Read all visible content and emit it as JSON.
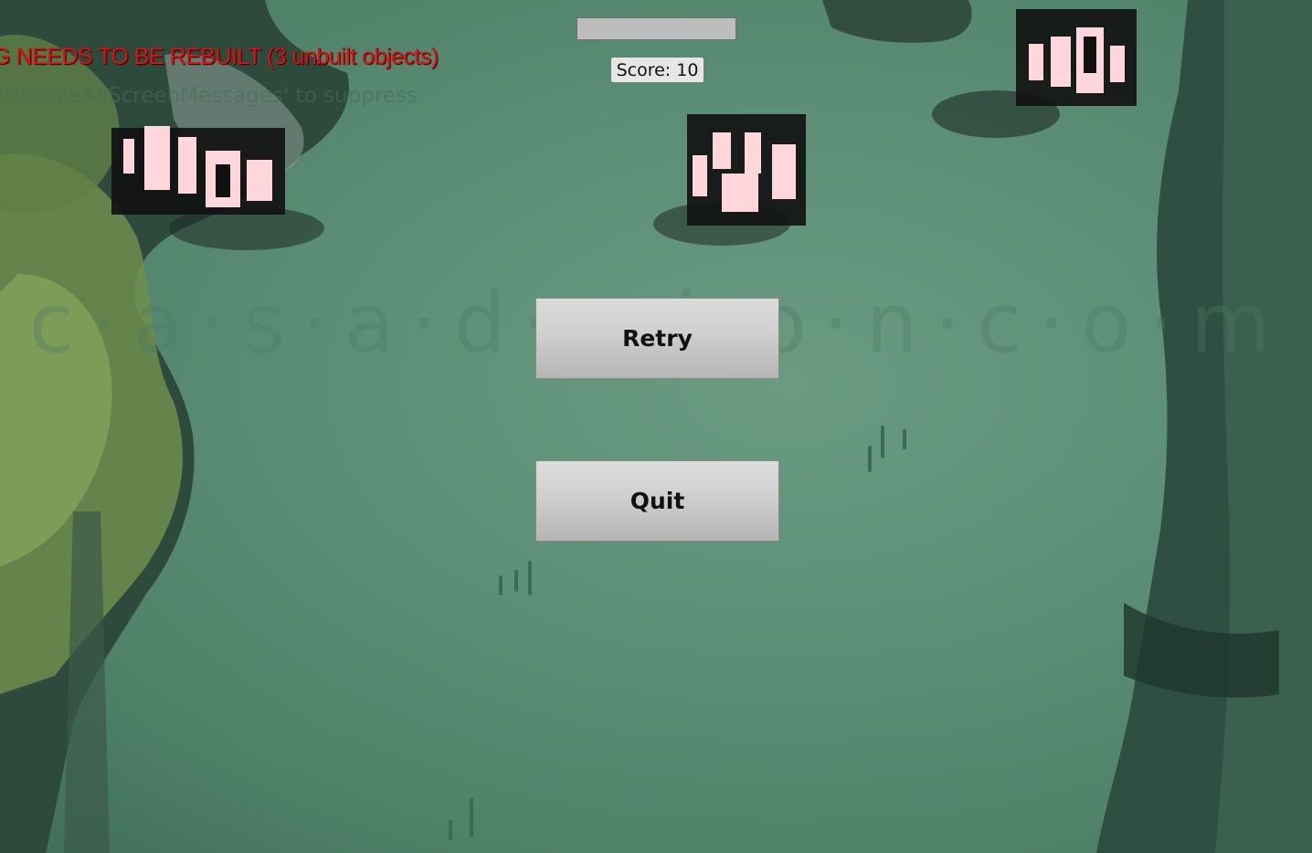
{
  "debug": {
    "lighting_warning": "G NEEDS TO BE REBUILT (3 unbuilt objects)",
    "suppress_hint": "'DisableAllScreenMessages' to suppress"
  },
  "hud": {
    "health_fraction": 1.0,
    "score_text": "Score: 10"
  },
  "menu": {
    "retry_label": "Retry",
    "quit_label": "Quit"
  },
  "scene": {
    "watermark": "c-a-s-a-d-e-l-o-n.com",
    "enemy_count": 3,
    "colors": {
      "background": "#5d8f78",
      "enemy_glow": "#ffd6dc",
      "warning_text": "#e01010"
    }
  }
}
